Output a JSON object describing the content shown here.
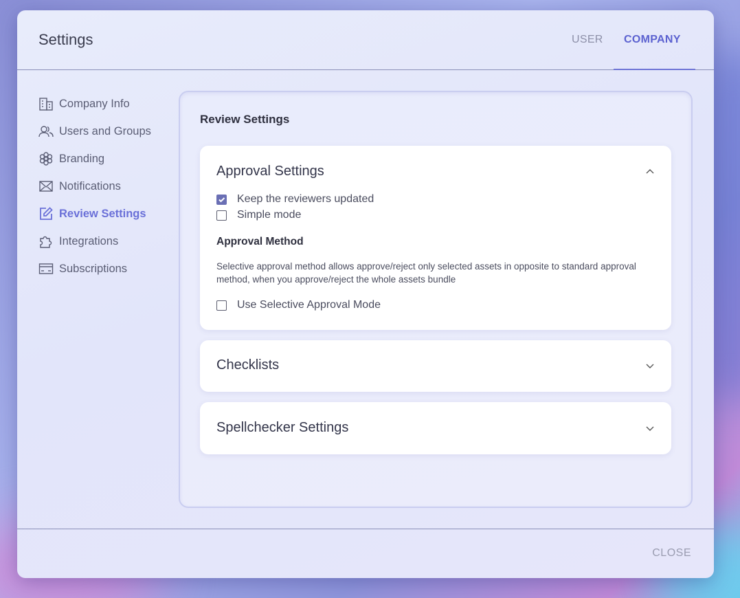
{
  "header": {
    "title": "Settings",
    "tabs": [
      {
        "label": "USER",
        "active": false
      },
      {
        "label": "COMPANY",
        "active": true
      }
    ]
  },
  "sidebar": {
    "items": [
      {
        "label": "Company Info",
        "icon": "building-icon"
      },
      {
        "label": "Users and Groups",
        "icon": "users-icon"
      },
      {
        "label": "Branding",
        "icon": "flower-icon"
      },
      {
        "label": "Notifications",
        "icon": "envelope-icon"
      },
      {
        "label": "Review Settings",
        "icon": "edit-icon",
        "active": true
      },
      {
        "label": "Integrations",
        "icon": "puzzle-icon"
      },
      {
        "label": "Subscriptions",
        "icon": "card-icon"
      }
    ]
  },
  "main": {
    "title": "Review Settings",
    "approval": {
      "title": "Approval Settings",
      "keep_updated_label": "Keep the reviewers updated",
      "keep_updated_checked": true,
      "simple_mode_label": "Simple mode",
      "simple_mode_checked": false,
      "method_title": "Approval Method",
      "method_desc": "Selective approval method allows approve/reject only selected assets in opposite to standard approval method, when you approve/reject the whole assets bundle",
      "selective_label": "Use Selective Approval Mode",
      "selective_checked": false
    },
    "checklists": {
      "title": "Checklists"
    },
    "spellchecker": {
      "title": "Spellchecker Settings"
    }
  },
  "footer": {
    "close_label": "CLOSE"
  },
  "colors": {
    "accent": "#5c62d0",
    "checkbox": "#6a6fb4"
  }
}
